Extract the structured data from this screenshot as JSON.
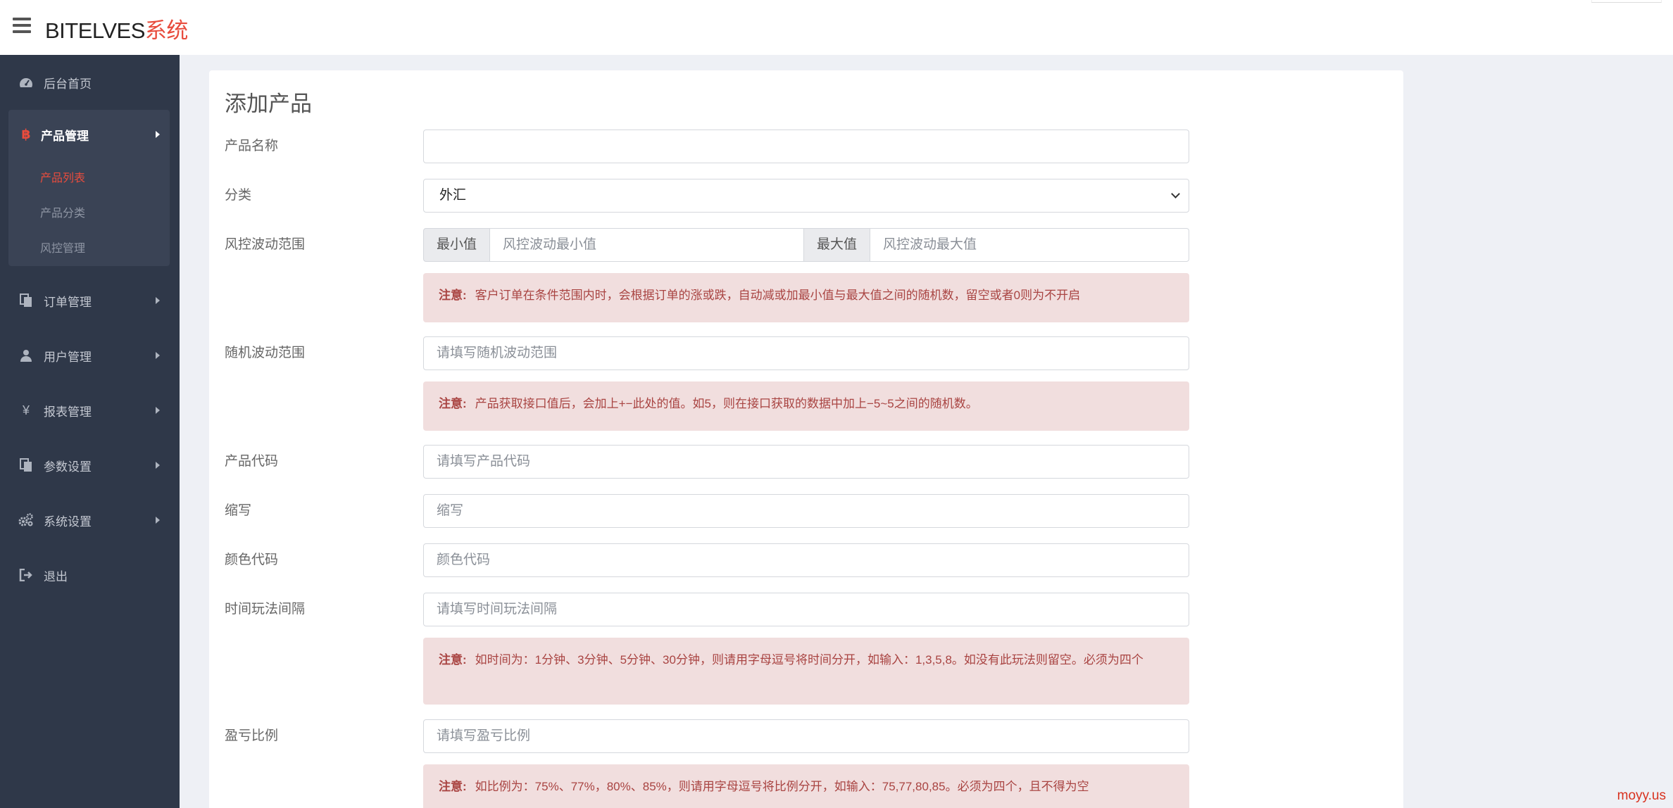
{
  "header": {
    "brand_main": "BITELVES",
    "brand_accent": "系统"
  },
  "sidebar": {
    "items": [
      {
        "label": "后台首页",
        "icon": "dashboard-icon"
      },
      {
        "label": "产品管理",
        "icon": "bitcoin-icon",
        "expanded": true,
        "children": [
          {
            "label": "产品列表",
            "active": true
          },
          {
            "label": "产品分类",
            "active": false
          },
          {
            "label": "风控管理",
            "active": false
          }
        ]
      },
      {
        "label": "订单管理",
        "icon": "copy-icon"
      },
      {
        "label": "用户管理",
        "icon": "user-icon"
      },
      {
        "label": "报表管理",
        "icon": "yen-icon"
      },
      {
        "label": "参数设置",
        "icon": "copy-icon"
      },
      {
        "label": "系统设置",
        "icon": "gears-icon"
      },
      {
        "label": "退出",
        "icon": "sign-out-icon"
      }
    ]
  },
  "form": {
    "title": "添加产品",
    "product_name": {
      "label": "产品名称",
      "value": "",
      "placeholder": ""
    },
    "category": {
      "label": "分类",
      "selected": "外汇"
    },
    "risk_range": {
      "label": "风控波动范围",
      "min_addon": "最小值",
      "min_placeholder": "风控波动最小值",
      "max_addon": "最大值",
      "max_placeholder": "风控波动最大值",
      "note_prefix": "注意:",
      "note": "客户订单在条件范围内时，会根据订单的涨或跌，自动减或加最小值与最大值之间的随机数，留空或者0则为不开启"
    },
    "random_range": {
      "label": "随机波动范围",
      "placeholder": "请填写随机波动范围",
      "note_prefix": "注意:",
      "note": "产品获取接口值后，会加上+−此处的值。如5，则在接口获取的数据中加上−5~5之间的随机数。"
    },
    "product_code": {
      "label": "产品代码",
      "placeholder": "请填写产品代码"
    },
    "abbreviation": {
      "label": "缩写",
      "placeholder": "缩写"
    },
    "color_code": {
      "label": "颜色代码",
      "placeholder": "颜色代码"
    },
    "time_interval": {
      "label": "时间玩法间隔",
      "placeholder": "请填写时间玩法间隔",
      "note_prefix": "注意:",
      "note": "如时间为：1分钟、3分钟、5分钟、30分钟，则请用字母逗号将时间分开，如输入：1,3,5,8。如没有此玩法则留空。必须为四个"
    },
    "profit_ratio": {
      "label": "盈亏比例",
      "placeholder": "请填写盈亏比例",
      "note_prefix": "注意:",
      "note": "如比例为：75%、77%，80%、85%，则请用字母逗号将比例分开，如输入：75,77,80,85。必须为四个，且不得为空"
    }
  },
  "watermark": "moyy.us",
  "colors": {
    "accent": "#e84c3d",
    "sidebar_bg": "#2f3849",
    "alert_bg": "#f1dede",
    "alert_text": "#a94442"
  }
}
